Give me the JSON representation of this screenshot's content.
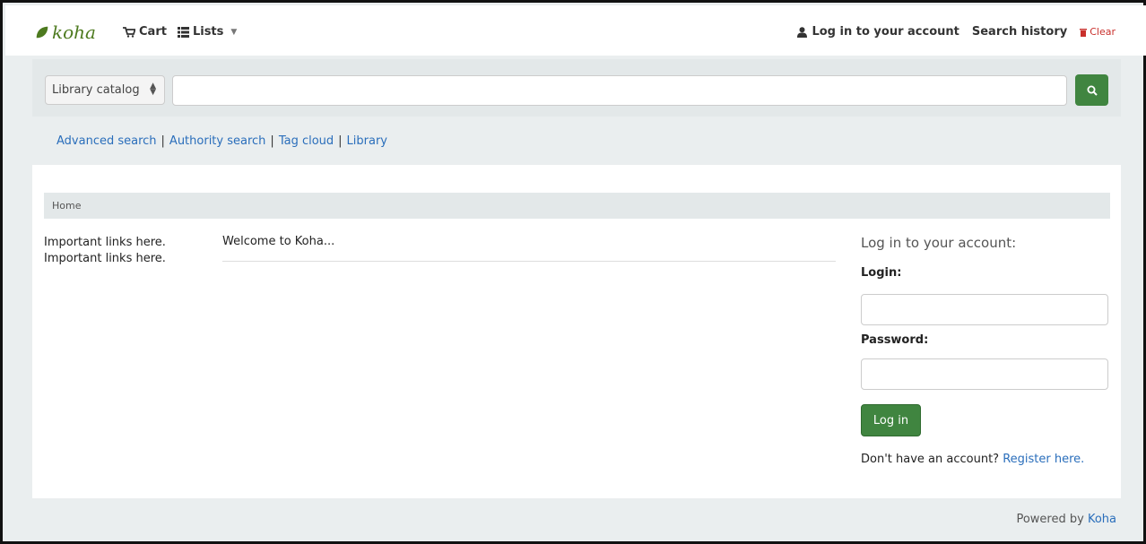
{
  "header": {
    "logo_text": "koha",
    "cart_label": "Cart",
    "lists_label": "Lists",
    "login_link": "Log in to your account",
    "search_history": "Search history",
    "clear_label": "Clear"
  },
  "search": {
    "select_value": "Library catalog",
    "query_value": "",
    "button_icon": "search-icon"
  },
  "more_searches": [
    "Advanced search",
    "Authority search",
    "Tag cloud",
    "Library"
  ],
  "breadcrumb": {
    "home": "Home"
  },
  "left_links": [
    "Important links here.",
    "Important links here."
  ],
  "main_text": "Welcome to Koha...",
  "login": {
    "heading": "Log in to your account:",
    "login_label": "Login:",
    "login_value": "",
    "password_label": "Password:",
    "password_value": "",
    "button": "Log in",
    "no_account": "Don't have an account?",
    "register": "Register here."
  },
  "footer": {
    "powered_by": "Powered by",
    "koha_link": "Koha"
  },
  "colors": {
    "brand_green": "#408540",
    "link_blue": "#2a6ebb",
    "clear_red": "#c9302c"
  }
}
